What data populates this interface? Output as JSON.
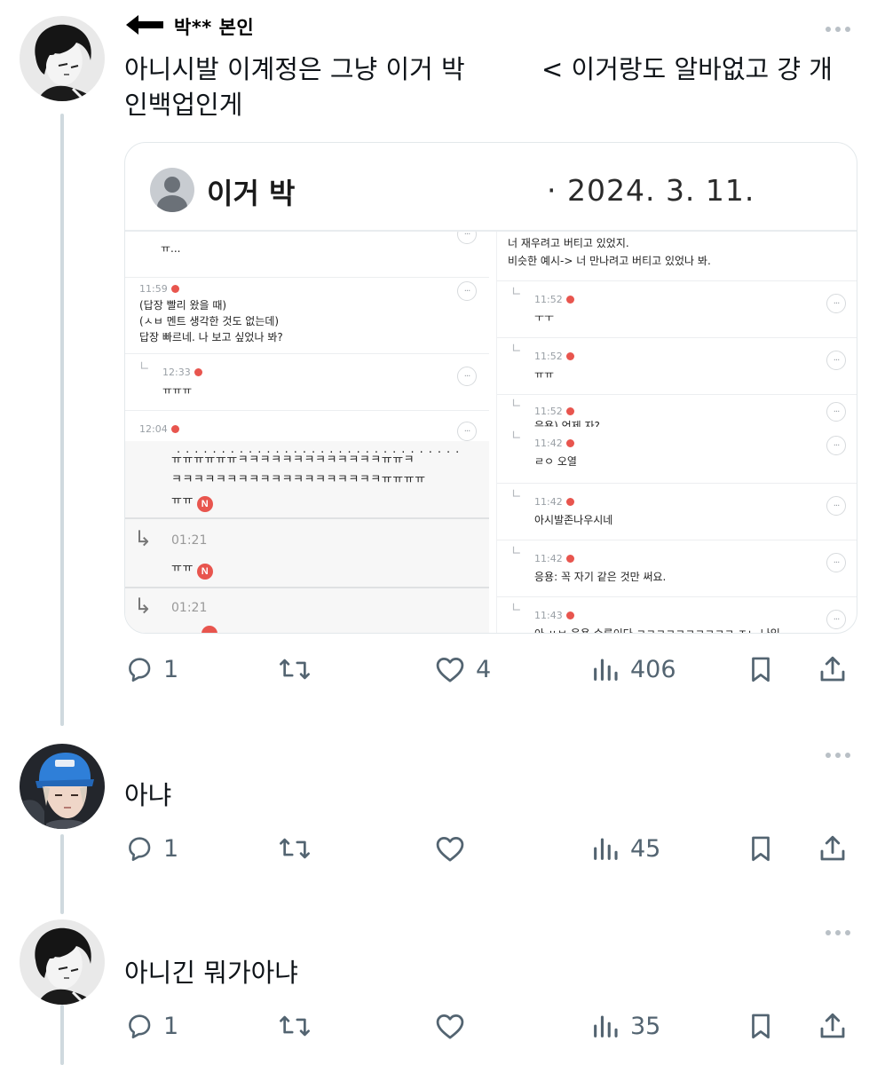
{
  "annotation": {
    "label": "박** 본인"
  },
  "posts": [
    {
      "text_line1": "아니시발 이계정은 그냥 이거 박",
      "text_line1_right": "< 이거랑도 알바없고 걍 개",
      "text_line2": "인백업인게",
      "actions": {
        "replies": "1",
        "likes": "4",
        "views": "406"
      }
    },
    {
      "text": "아냐",
      "actions": {
        "replies": "1",
        "likes": "",
        "views": "45"
      }
    },
    {
      "text": "아니긴 뭐가아냐",
      "actions": {
        "replies": "1",
        "likes": "",
        "views": "35"
      }
    }
  ],
  "card": {
    "name": "이거 박",
    "date": "· 2024. 3. 11.",
    "left": {
      "c0_line": "ㅠ...",
      "c1_time": "11:59",
      "c1_lines": [
        "(답장 빨리 왔을 때)",
        "(ㅅㅂ 멘트 생각한 것도 없는데)",
        "답장 빠르네. 나 보고 싶었나 봐?"
      ],
      "c2_time": "12:33",
      "c2_line": "ㅠㅠㅠ",
      "c3_time": "12:04",
      "overlay_line1": "ㅠㅠㅠㅠㅠㅠㅋㅋㅋㅋㅋㅋㅋㅋㅋㅋㅋㅋㅋㅠㅠㅋ",
      "overlay_line2": "ㅋㅋㅋㅋㅋㅋㅋㅋㅋㅋㅋㅋㅋㅋㅋㅋㅋㅋㅋㅠㅠㅠㅠ",
      "overlay_line3": "ㅠㅠ",
      "overlay_time1": "01:21",
      "overlay_line4": "ㅠㅠ",
      "overlay_time2": "01:21",
      "badge": "N"
    },
    "right": {
      "c0_line1": "너 재우려고 버티고 있었지.",
      "c0_line2": "비슷한 예시-> 너 만나려고 버티고 있었나 봐.",
      "c1_time": "11:52",
      "c1_line": "ㅜㅜ",
      "c2_time": "11:52",
      "c2_line": "ㅠㅠ",
      "c3_time": "11:52",
      "c3_line": "응용) 언제 자?",
      "c4_time": "11:42",
      "c4_line": "ㄹㅇ 오열",
      "c5_time": "11:42",
      "c5_line": "아시발존나우시네",
      "c6_time": "11:42",
      "c6_line": "응용: 꼭 자기 같은 것만 써요.",
      "c7_time": "11:43",
      "c7_line": "아 ㅆㅂ 응용 수류이다 ㅋㅋㅋㅋㅋㅋㅋㅋㅋㅋ ㅈㄴ 나임"
    }
  }
}
